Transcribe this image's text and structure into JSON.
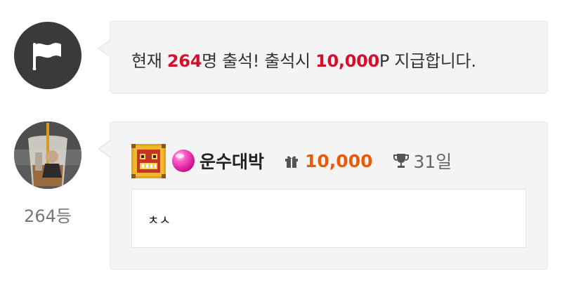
{
  "notice": {
    "prefix": "현재 ",
    "count": "264",
    "middle": "명 출석! 출석시 ",
    "reward": "10,000",
    "suffix": "P 지급합니다."
  },
  "entry": {
    "rank_label": "264등",
    "username": "운수대박",
    "points": "10,000",
    "days": "31일",
    "comment": "ㅊㅅ"
  },
  "icons": {
    "flag": "flag-icon",
    "level": "level-badge-icon",
    "gem": "pink-gem-icon",
    "gift": "gift-icon",
    "trophy": "trophy-icon"
  },
  "colors": {
    "highlight_red": "#d4102b",
    "points_orange": "#ec5a08",
    "bubble_bg": "#f4f4f4",
    "flag_circle": "#3a3a3a"
  }
}
